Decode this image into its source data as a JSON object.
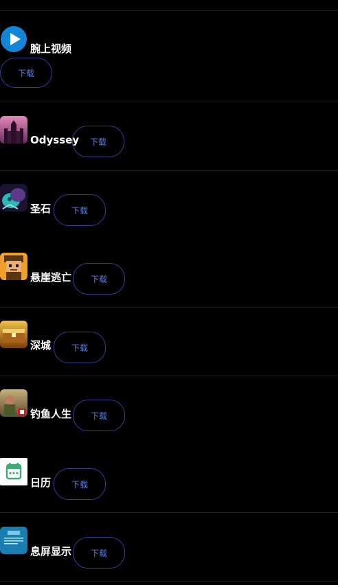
{
  "apps": [
    {
      "name": "腕上视频",
      "icon": "play-video-icon",
      "button": "下载"
    },
    {
      "name": "Odyssey",
      "icon": "odyssey-castle-icon",
      "button": "下载"
    },
    {
      "name": "圣石",
      "icon": "holy-stone-monster-icon",
      "button": "下载"
    },
    {
      "name": "悬崖逃亡",
      "icon": "cliff-escape-character-icon",
      "button": "下载"
    },
    {
      "name": "深城",
      "icon": "deep-city-chest-icon",
      "button": "下载"
    },
    {
      "name": "钓鱼人生",
      "icon": "fishing-life-icon",
      "button": "下载"
    },
    {
      "name": "日历",
      "icon": "calendar-icon",
      "button": "下载"
    },
    {
      "name": "息屏显示",
      "icon": "always-on-display-icon",
      "button": "下载"
    }
  ],
  "colors": {
    "background": "#000000",
    "divider": "#1f1f1f",
    "button_border": "#2f3f9a",
    "button_text": "#5d7fe6",
    "title_text": "#ffffff"
  }
}
